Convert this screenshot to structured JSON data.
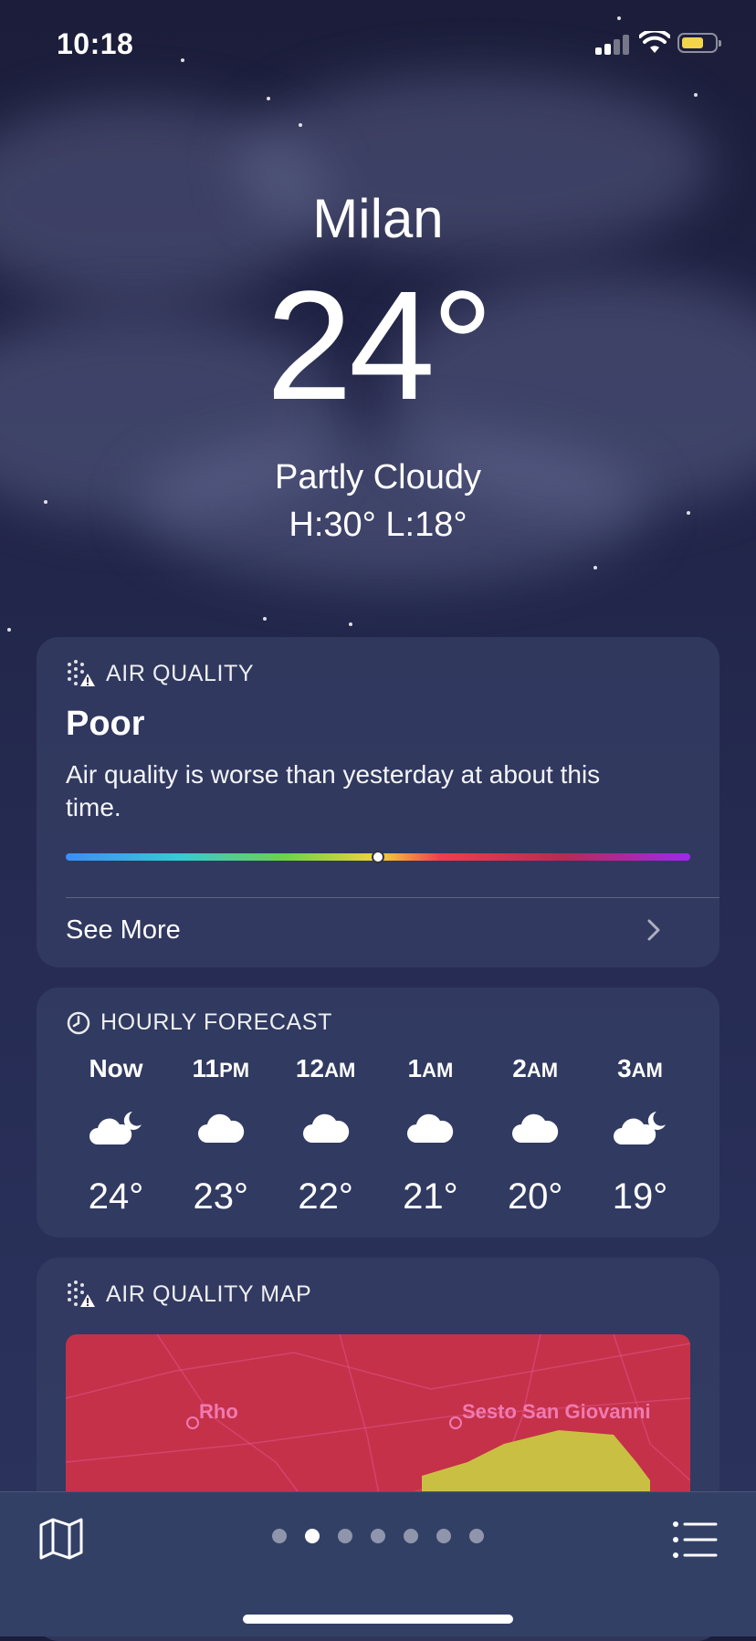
{
  "status": {
    "time": "10:18"
  },
  "location": {
    "city": "Milan",
    "temperature": "24°",
    "condition": "Partly Cloudy",
    "high_low": "H:30°  L:18°"
  },
  "air_quality": {
    "title": "AIR QUALITY",
    "level": "Poor",
    "description": "Air quality is worse than yesterday at about this time.",
    "scale_position": 0.5,
    "see_more": "See More"
  },
  "hourly": {
    "title": "HOURLY FORECAST",
    "hours": [
      {
        "label": "Now",
        "suffix": "",
        "icon": "cloud-moon-icon",
        "temp": "24°"
      },
      {
        "label": "11",
        "suffix": "PM",
        "icon": "cloud-icon",
        "temp": "23°"
      },
      {
        "label": "12",
        "suffix": "AM",
        "icon": "cloud-icon",
        "temp": "22°"
      },
      {
        "label": "1",
        "suffix": "AM",
        "icon": "cloud-icon",
        "temp": "21°"
      },
      {
        "label": "2",
        "suffix": "AM",
        "icon": "cloud-icon",
        "temp": "20°"
      },
      {
        "label": "3",
        "suffix": "AM",
        "icon": "cloud-moon-icon",
        "temp": "19°"
      }
    ]
  },
  "air_quality_map": {
    "title": "AIR QUALITY MAP",
    "places": [
      "Rho",
      "Sesto San Giovanni"
    ]
  },
  "pager": {
    "count": 7,
    "active_index": 1
  },
  "colors": {
    "poor_map": "#c53149",
    "moderate_map": "#c9c043",
    "battery": "#f2d54a"
  }
}
